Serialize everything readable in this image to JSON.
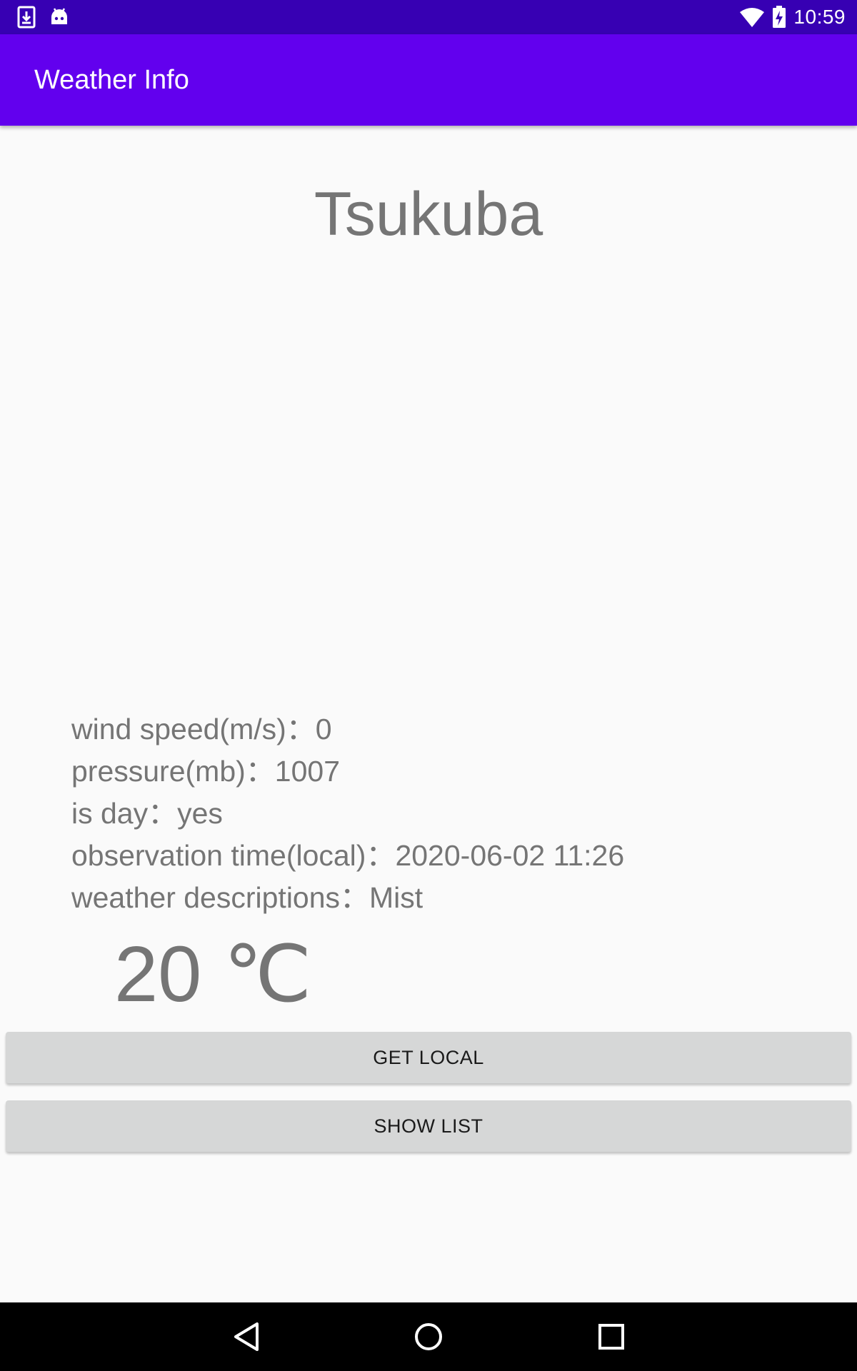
{
  "status_bar": {
    "time": "10:59",
    "icons": [
      "download-icon",
      "android-icon",
      "wifi-icon",
      "battery-charging-icon"
    ]
  },
  "app_bar": {
    "title": "Weather Info"
  },
  "weather": {
    "city": "Tsukuba",
    "details": [
      {
        "label": "wind speed(m/s)：",
        "value": "0"
      },
      {
        "label": "pressure(mb)：",
        "value": "1007"
      },
      {
        "label": "is day：",
        "value": "yes"
      },
      {
        "label": "observation time(local)：",
        "value": "2020-06-02 11:26"
      },
      {
        "label": "weather descriptions：",
        "value": "Mist"
      }
    ],
    "temperature": "20 ℃"
  },
  "buttons": {
    "get_local": "GET LOCAL",
    "show_list": "SHOW LIST"
  },
  "nav_bar": {
    "icons": [
      "back-icon",
      "home-icon",
      "recents-icon"
    ]
  },
  "colors": {
    "status_bar": "#3700b3",
    "app_bar": "#6200ee",
    "text_secondary": "#757575",
    "button_bg": "#d6d7d7"
  }
}
